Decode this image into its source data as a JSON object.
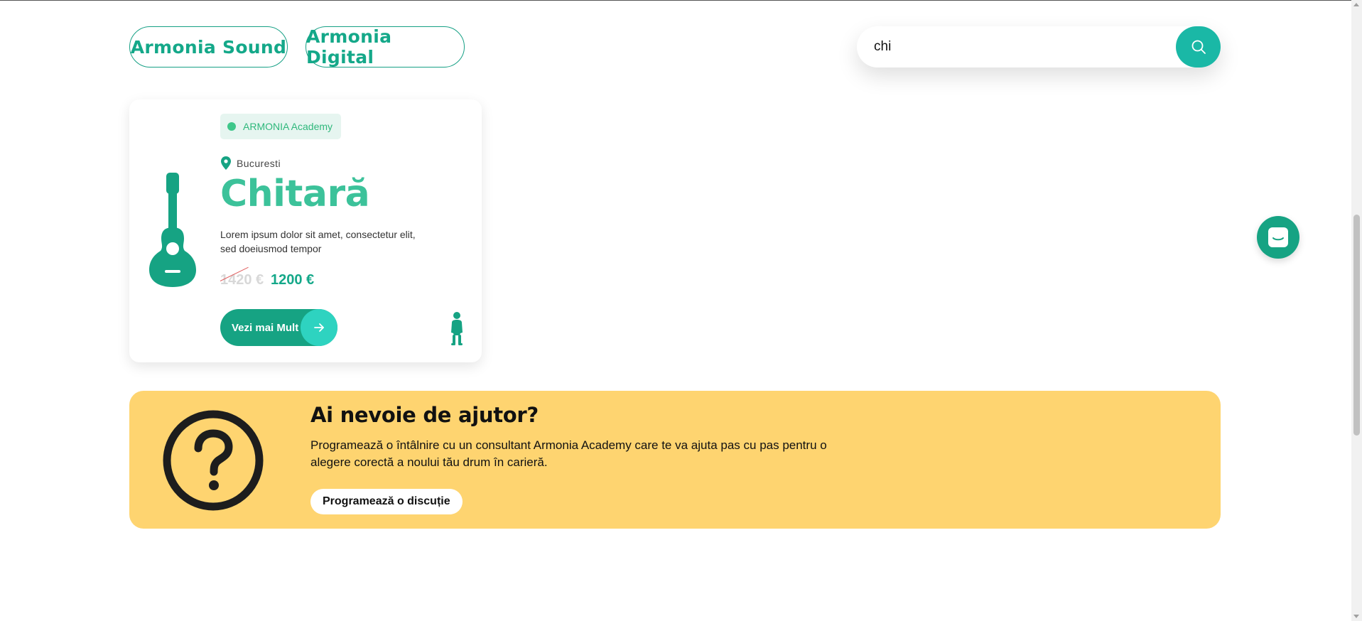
{
  "filters": [
    {
      "label": "Armonia Sound"
    },
    {
      "label": "Armonia Digital"
    }
  ],
  "search": {
    "value": "chi"
  },
  "card": {
    "badge": "ARMONIA Academy",
    "location": "Bucuresti",
    "title": "Chitară",
    "description": "Lorem ipsum dolor sit amet, consectetur elit, sed doeiusmod tempor",
    "price_old": "1420 €",
    "price_new": "1200 €",
    "button_label": "Vezi mai Mult"
  },
  "help": {
    "title": "Ai nevoie de ajutor?",
    "text": "Programează o întâlnire cu un consultant Armonia Academy care te va ajuta pas cu pas pentru o alegere corectă a noului tău drum în carieră.",
    "cta": "Programează o discuție"
  },
  "colors": {
    "accent": "#16a383",
    "accent_light": "#2ed3c0",
    "banner": "#fed470"
  },
  "icons": [
    "search-icon",
    "guitar-icon",
    "location-pin-icon",
    "arrow-right-icon",
    "child-icon",
    "question-circle-icon",
    "chat-icon"
  ]
}
